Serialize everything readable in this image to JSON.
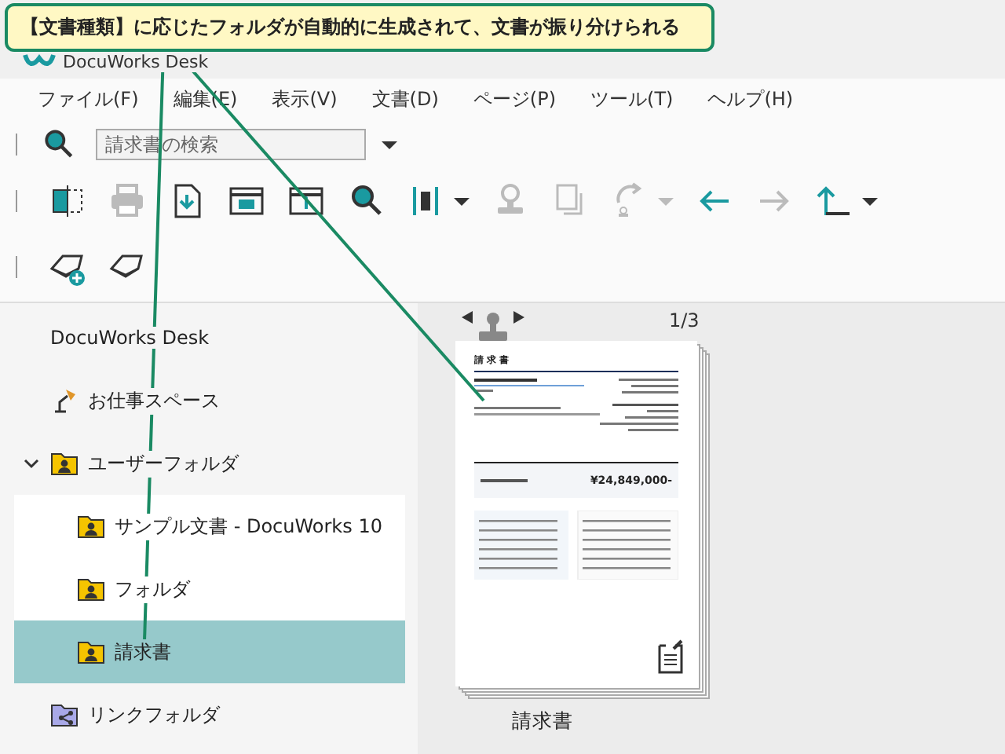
{
  "callout": {
    "text": "【文書種類】に応じたフォルダが自動的に生成されて、文書が振り分けられる"
  },
  "window": {
    "title": "DocuWorks Desk"
  },
  "menu": [
    "ファイル(F)",
    "編集(E)",
    "表示(V)",
    "文書(D)",
    "ページ(P)",
    "ツール(T)",
    "ヘルプ(H)"
  ],
  "search": {
    "placeholder": "請求書の検索"
  },
  "toolbar": [
    {
      "kind": "split",
      "disabled": false
    },
    {
      "kind": "print",
      "disabled": true
    },
    {
      "kind": "import",
      "disabled": false
    },
    {
      "kind": "window",
      "disabled": false
    },
    {
      "kind": "info",
      "disabled": false
    },
    {
      "kind": "search",
      "disabled": false
    },
    {
      "kind": "viewmode",
      "disabled": false
    },
    {
      "kind": "caret",
      "disabled": false
    },
    {
      "kind": "stamp",
      "disabled": true
    },
    {
      "kind": "copy",
      "disabled": true
    },
    {
      "kind": "rotate",
      "disabled": true
    },
    {
      "kind": "caret",
      "disabled": true
    },
    {
      "kind": "back",
      "disabled": false
    },
    {
      "kind": "forward",
      "disabled": true
    },
    {
      "kind": "up",
      "disabled": false
    },
    {
      "kind": "caret",
      "disabled": false
    }
  ],
  "toolbar2": [
    {
      "kind": "tray-add",
      "disabled": false
    },
    {
      "kind": "tray",
      "disabled": false
    }
  ],
  "tree": [
    {
      "label": "DocuWorks Desk",
      "kind": "desk",
      "selected": false
    },
    {
      "label": "お仕事スペース",
      "kind": "workspace",
      "selected": false
    },
    {
      "label": "ユーザーフォルダ",
      "kind": "folder",
      "selected": false,
      "expanded": true,
      "children": [
        {
          "label": "サンプル文書 - DocuWorks 10",
          "kind": "folder",
          "selected": false
        },
        {
          "label": "フォルダ",
          "kind": "folder",
          "selected": false
        },
        {
          "label": "請求書",
          "kind": "folder",
          "selected": true
        }
      ]
    },
    {
      "label": "リンクフォルダ",
      "kind": "link",
      "selected": false
    }
  ],
  "document": {
    "page": "1/3",
    "heading": "請 求 書",
    "amount": "¥24,849,000-",
    "name": "請求書"
  }
}
